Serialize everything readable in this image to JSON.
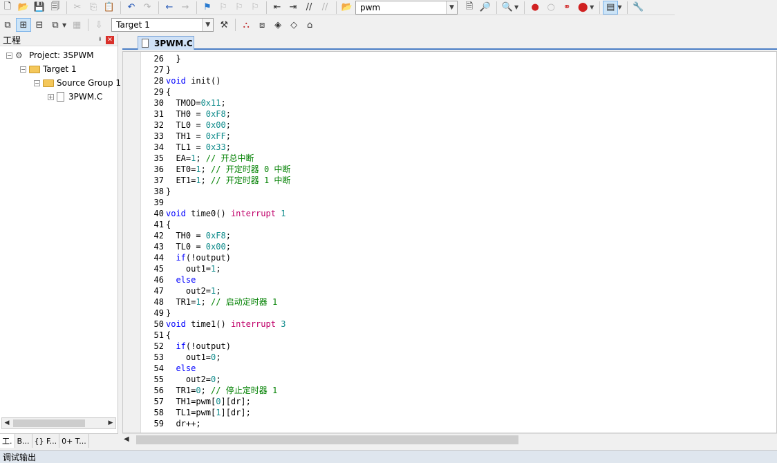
{
  "toolbar1": {
    "find_combo_value": "pwm"
  },
  "toolbar2": {
    "target_combo_value": "Target 1"
  },
  "project_panel": {
    "title": "工程",
    "tree": [
      {
        "label": "Project: 3SPWM",
        "level": 0
      },
      {
        "label": "Target 1",
        "level": 1
      },
      {
        "label": "Source Group 1",
        "level": 2
      },
      {
        "label": "3PWM.C",
        "level": 3
      }
    ],
    "tabs": [
      "工.",
      "B...",
      "{} F...",
      "0+ T..."
    ]
  },
  "editor": {
    "active_tab": "3PWM.C",
    "lines": [
      {
        "n": 26,
        "code": "  }"
      },
      {
        "n": 27,
        "code": "}"
      },
      {
        "n": 28,
        "code": "void init()"
      },
      {
        "n": 29,
        "code": "{"
      },
      {
        "n": 30,
        "code": "  TMOD=0x11;"
      },
      {
        "n": 31,
        "code": "  TH0 = 0xF8;"
      },
      {
        "n": 32,
        "code": "  TL0 = 0x00;"
      },
      {
        "n": 33,
        "code": "  TH1 = 0xFF;"
      },
      {
        "n": 34,
        "code": "  TL1 = 0x33;"
      },
      {
        "n": 35,
        "code": "  EA=1; // 开总中断"
      },
      {
        "n": 36,
        "code": "  ET0=1; // 开定时器 0 中断"
      },
      {
        "n": 37,
        "code": "  ET1=1; // 开定时器 1 中断"
      },
      {
        "n": 38,
        "code": "}"
      },
      {
        "n": 39,
        "code": ""
      },
      {
        "n": 40,
        "code": "void time0() interrupt 1"
      },
      {
        "n": 41,
        "code": "{"
      },
      {
        "n": 42,
        "code": "  TH0 = 0xF8;"
      },
      {
        "n": 43,
        "code": "  TL0 = 0x00;"
      },
      {
        "n": 44,
        "code": "  if(!output)"
      },
      {
        "n": 45,
        "code": "    out1=1;"
      },
      {
        "n": 46,
        "code": "  else"
      },
      {
        "n": 47,
        "code": "    out2=1;"
      },
      {
        "n": 48,
        "code": "  TR1=1; // 启动定时器 1"
      },
      {
        "n": 49,
        "code": "}"
      },
      {
        "n": 50,
        "code": "void time1() interrupt 3"
      },
      {
        "n": 51,
        "code": "{"
      },
      {
        "n": 52,
        "code": "  if(!output)"
      },
      {
        "n": 53,
        "code": "    out1=0;"
      },
      {
        "n": 54,
        "code": "  else"
      },
      {
        "n": 55,
        "code": "    out2=0;"
      },
      {
        "n": 56,
        "code": "  TR1=0; // 停止定时器 1"
      },
      {
        "n": 57,
        "code": "  TH1=pwm[0][dr];"
      },
      {
        "n": 58,
        "code": "  TL1=pwm[1][dr];"
      },
      {
        "n": 59,
        "code": "  dr++;"
      }
    ]
  },
  "status": {
    "text": "调试输出"
  }
}
